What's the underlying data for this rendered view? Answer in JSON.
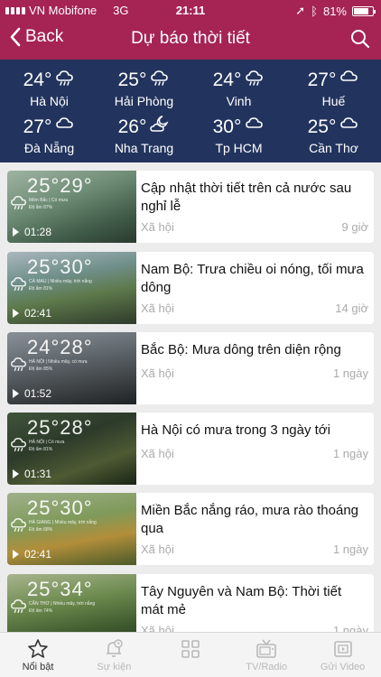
{
  "status": {
    "carrier": "VN Mobifone",
    "network": "3G",
    "time": "21:11",
    "battery": "81%",
    "battery_level": 0.81
  },
  "nav": {
    "back_label": "Back",
    "title": "Dự báo thời tiết"
  },
  "cities": [
    {
      "temp": "24°",
      "name": "Hà Nội",
      "icon": "rain-cloud-icon"
    },
    {
      "temp": "25°",
      "name": "Hải Phòng",
      "icon": "rain-cloud-icon"
    },
    {
      "temp": "24°",
      "name": "Vinh",
      "icon": "rain-cloud-icon"
    },
    {
      "temp": "27°",
      "name": "Huế",
      "icon": "cloud-icon"
    },
    {
      "temp": "27°",
      "name": "Đà Nẵng",
      "icon": "cloud-icon"
    },
    {
      "temp": "26°",
      "name": "Nha Trang",
      "icon": "moon-cloud-icon"
    },
    {
      "temp": "30°",
      "name": "Tp HCM",
      "icon": "cloud-icon"
    },
    {
      "temp": "25°",
      "name": "Cần Thơ",
      "icon": "cloud-icon"
    }
  ],
  "videos": [
    {
      "title": "Cập nhật thời tiết trên cả nước sau nghỉ lễ",
      "category": "Xã hội",
      "ago": "9 giờ",
      "duration": "01:28",
      "thumb_temp": "25°29°",
      "thumb_region": "Miền Bắc | Có mưa",
      "thumb_humidity": "Độ ẩm 87%"
    },
    {
      "title": "Nam Bộ: Trưa chiều oi nóng, tối mưa dông",
      "category": "Xã hội",
      "ago": "14 giờ",
      "duration": "02:41",
      "thumb_temp": "25°30°",
      "thumb_region": "CÀ MAU | Nhiều mây, trời nắng",
      "thumb_humidity": "Độ ẩm 81%"
    },
    {
      "title": "Bắc Bộ: Mưa dông trên diện rộng",
      "category": "Xã hội",
      "ago": "1 ngày",
      "duration": "01:52",
      "thumb_temp": "24°28°",
      "thumb_region": "HÀ NỘI | Nhiều mây, có mưa",
      "thumb_humidity": "Độ ẩm 85%"
    },
    {
      "title": "Hà Nội có mưa trong 3 ngày tới",
      "category": "Xã hội",
      "ago": "1 ngày",
      "duration": "01:31",
      "thumb_temp": "25°28°",
      "thumb_region": "HÀ NỘI | Có mưa",
      "thumb_humidity": "Độ ẩm 81%"
    },
    {
      "title": "Miền Bắc nắng ráo, mưa rào thoáng qua",
      "category": "Xã hội",
      "ago": "1 ngày",
      "duration": "02:41",
      "thumb_temp": "25°30°",
      "thumb_region": "HÀ GIANG | Nhiều mây, trời nắng",
      "thumb_humidity": "Độ ẩm 68%"
    },
    {
      "title": "Tây Nguyên và Nam Bộ: Thời tiết mát mẻ",
      "category": "Xã hội",
      "ago": "1 ngày",
      "duration": "",
      "thumb_temp": "25°34°",
      "thumb_region": "CẦN THƠ | Nhiều mây, trời nắng",
      "thumb_humidity": "Độ ẩm 74%"
    }
  ],
  "tabs": [
    {
      "label": "Nổi bật",
      "icon": "star-icon",
      "active": true
    },
    {
      "label": "Sự kiện",
      "icon": "alarm-icon",
      "active": false
    },
    {
      "label": "",
      "icon": "grid-icon",
      "active": false
    },
    {
      "label": "TV/Radio",
      "icon": "tv-icon",
      "active": false
    },
    {
      "label": "Gửi Video",
      "icon": "video-upload-icon",
      "active": false
    }
  ],
  "colors": {
    "header": "#a52453",
    "cities_bg": "#22345e",
    "page_bg": "#ececec"
  }
}
